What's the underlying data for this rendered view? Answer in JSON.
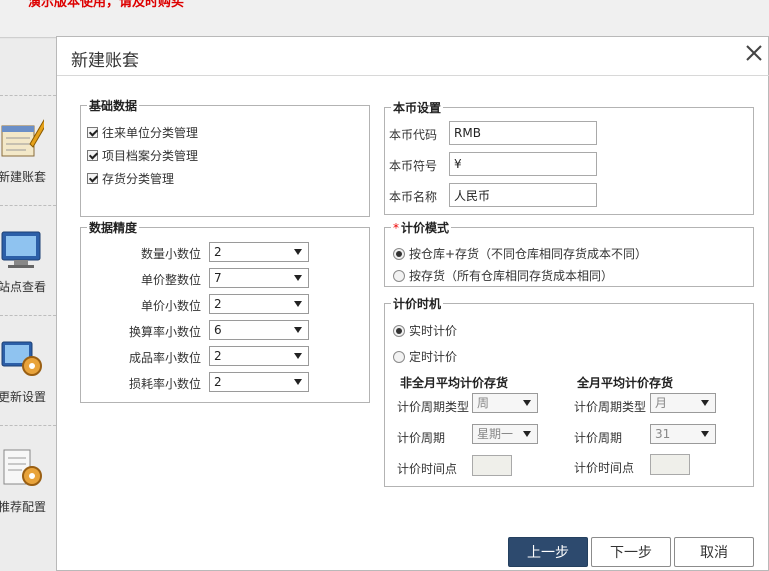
{
  "app": {
    "notice": "演示版本使用，请及时购买",
    "sidebar": [
      {
        "label": "新建账套",
        "icon": "ledger-pencil-icon"
      },
      {
        "label": "站点查看",
        "icon": "monitor-icon"
      },
      {
        "label": "更新设置",
        "icon": "monitor-gear-icon"
      },
      {
        "label": "推荐配置",
        "icon": "document-gear-icon"
      }
    ]
  },
  "dialog": {
    "title": "新建账套",
    "basic": {
      "title": "基础数据",
      "items": [
        {
          "label": "往来单位分类管理",
          "checked": true
        },
        {
          "label": "项目档案分类管理",
          "checked": true
        },
        {
          "label": "存货分类管理",
          "checked": true
        }
      ]
    },
    "precision": {
      "title": "数据精度",
      "rows": [
        {
          "label": "数量小数位",
          "value": "2"
        },
        {
          "label": "单价整数位",
          "value": "7"
        },
        {
          "label": "单价小数位",
          "value": "2"
        },
        {
          "label": "换算率小数位",
          "value": "6"
        },
        {
          "label": "成品率小数位",
          "value": "2"
        },
        {
          "label": "损耗率小数位",
          "value": "2"
        }
      ]
    },
    "currency": {
      "title": "本币设置",
      "code_label": "本币代码",
      "code_value": "RMB",
      "symbol_label": "本币符号",
      "symbol_value": "¥",
      "name_label": "本币名称",
      "name_value": "人民币"
    },
    "pricing_mode": {
      "required_mark": "*",
      "title": "计价模式",
      "options": [
        {
          "label": "按仓库+存货（不同仓库相同存货成本不同）",
          "selected": true
        },
        {
          "label": "按存货（所有仓库相同存货成本相同）",
          "selected": false
        }
      ]
    },
    "pricing_time": {
      "title": "计价时机",
      "options": [
        {
          "label": "实时计价",
          "selected": true
        },
        {
          "label": "定时计价",
          "selected": false
        }
      ],
      "non_full_month": {
        "title": "非全月平均计价存货",
        "period_type_label": "计价周期类型",
        "period_type_value": "周",
        "period_label": "计价周期",
        "period_value": "星期一",
        "time_label": "计价时间点"
      },
      "full_month": {
        "title": "全月平均计价存货",
        "period_type_label": "计价周期类型",
        "period_type_value": "月",
        "period_label": "计价周期",
        "period_value": "31",
        "time_label": "计价时间点"
      }
    },
    "buttons": {
      "prev": "上一步",
      "next": "下一步",
      "cancel": "取消"
    }
  },
  "colors": {
    "primary_button": "#2d4a6e",
    "notice_red": "#dd0000",
    "required_red": "#ee0000"
  }
}
